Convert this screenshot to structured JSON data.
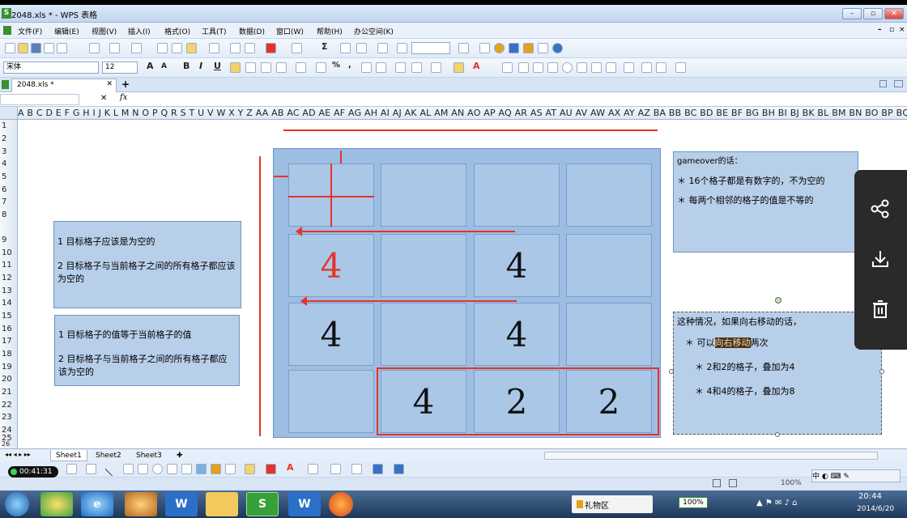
{
  "window": {
    "title": "2048.xls * - WPS 表格",
    "doc_tab": "2048.xls *",
    "min_label": "–",
    "max_label": "▫",
    "close_label": "✕"
  },
  "menu": [
    "文件(F)",
    "编辑(E)",
    "视图(V)",
    "插入(I)",
    "格式(O)",
    "工具(T)",
    "数据(D)",
    "窗口(W)",
    "帮助(H)",
    "办公空间(K)"
  ],
  "format": {
    "font_name": "宋体",
    "font_size": "12"
  },
  "columns": "A B C D E F G H I J K L M N O P Q R S T U V W X Y Z AA AB AC AD AE AF AG AH AI AJ AK AL AM AN AO AP AQ AR AS AT AU AV AW AX AY AZ BA BB BC BD BE BF BG BH BI BJ BK BL BM BN BO BP BQ BR BS BT BU BV BW BX BY BZ CA CB CC CD CE CF CG CH CI CJ CK CL CM CN CO CP CQ CR CS CT CU CV CW",
  "rows": [
    "1",
    "2",
    "3",
    "4",
    "5",
    "6",
    "7",
    "8",
    "9",
    "10",
    "11",
    "12",
    "13",
    "14",
    "15",
    "16",
    "17",
    "18",
    "19",
    "20",
    "21",
    "22",
    "23",
    "24",
    "25",
    "26"
  ],
  "notes": {
    "rule_empty": {
      "line1": "1 目标格子应该是为空的",
      "line2": "2 目标格子与当前格子之间的所有格子都应该为空的"
    },
    "rule_equal": {
      "line1": "1 目标格子的值等于当前格子的值",
      "line2": "2 目标格子与当前格子之间的所有格子都应该为空的"
    },
    "gameover": {
      "title": "gameover的话：",
      "item1": "＊ 16个格子都是有数字的，不为空的",
      "item2": "＊ 每两个相邻的格子的值是不等的"
    },
    "move_right": {
      "title": "这种情况，如果向右移动的话，",
      "item1_pre": "＊ 可以",
      "item1_hl": "向右移动",
      "item1_post": "两次",
      "item2": "＊ 2和2的格子，叠加为4",
      "item3": "＊ 4和4的格子，叠加为8"
    }
  },
  "board": {
    "cells": [
      [
        "",
        "",
        "",
        ""
      ],
      [
        "4",
        "",
        "4",
        ""
      ],
      [
        "4",
        "",
        "4",
        ""
      ],
      [
        "",
        "4",
        "2",
        "2"
      ]
    ],
    "highlight_color": "#e5332a"
  },
  "sheets": [
    "Sheet1",
    "Sheet2",
    "Sheet3"
  ],
  "add_sheet": "✚",
  "status": {
    "zoom": "100%",
    "timer": "00:41:31",
    "clock_time": "20:44",
    "clock_date": "2014/6/20",
    "gift_label": "礼物区"
  },
  "taskbar": {
    "wps_s": "S",
    "wps_w": "W"
  },
  "colors": {
    "accent": "#e5332a",
    "note_fill": "#b8cfe9",
    "board_fill": "#9dbde3"
  }
}
